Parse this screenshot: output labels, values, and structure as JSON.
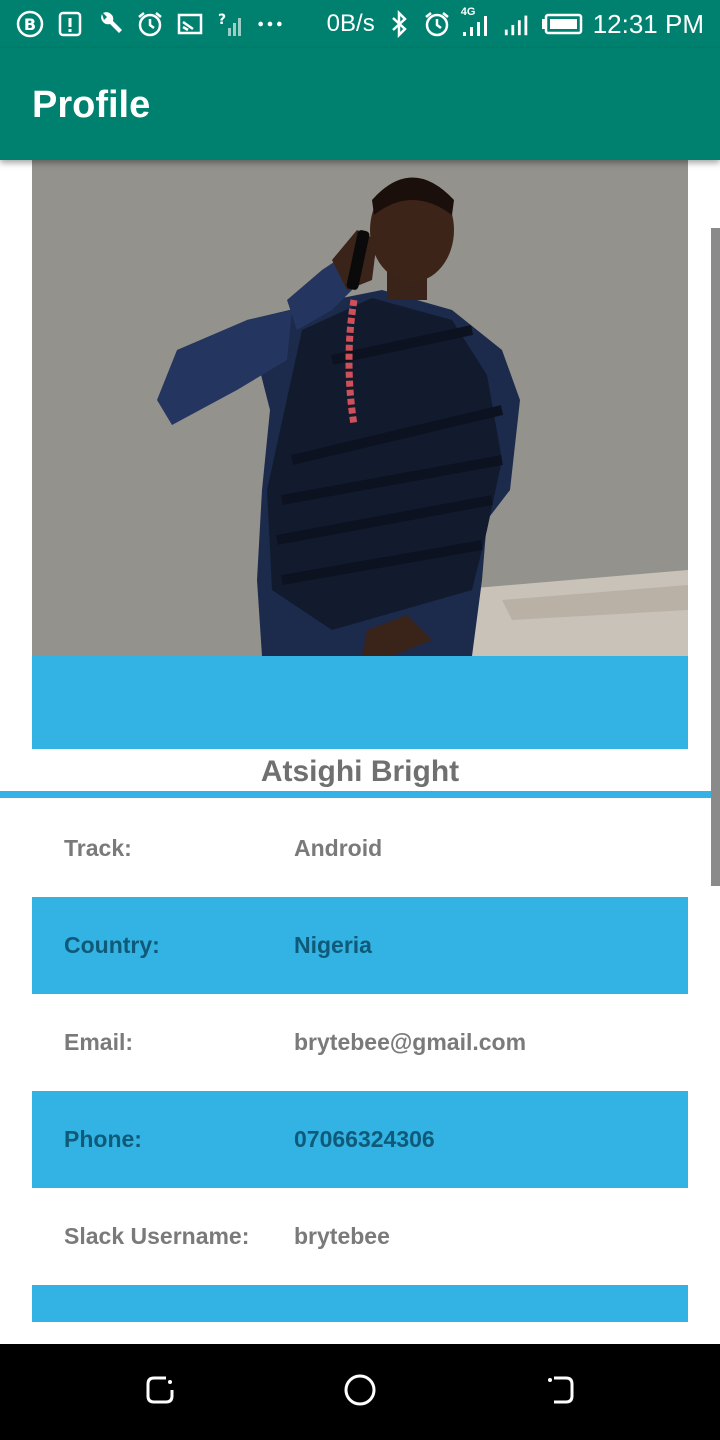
{
  "status_bar": {
    "network_speed": "0B/s",
    "network_type": "4G",
    "time": "12:31 PM",
    "icons_left": [
      "b-badge-icon",
      "alert-icon",
      "wrench-icon",
      "alarm-icon",
      "cast-icon",
      "signal-unknown-icon",
      "more-dots-icon"
    ],
    "icons_right": [
      "bluetooth-icon",
      "alarm-icon",
      "signal-4g-icon",
      "signal-icon",
      "battery-icon"
    ]
  },
  "app_bar": {
    "title": "Profile"
  },
  "profile": {
    "name": "Atsighi Bright",
    "photo_icon": "profile-photo"
  },
  "details": [
    {
      "label": "Track:",
      "value": "Android"
    },
    {
      "label": "Country:",
      "value": "Nigeria"
    },
    {
      "label": "Email:",
      "value": "brytebee@gmail.com"
    },
    {
      "label": "Phone:",
      "value": "07066324306"
    },
    {
      "label": "Slack Username:",
      "value": "brytebee"
    }
  ],
  "nav_bar": {
    "buttons": [
      "recents-icon",
      "home-icon",
      "back-icon"
    ]
  },
  "colors": {
    "primary": "#00816f",
    "accent": "#33b3e3",
    "label_text": "#7a7a7a",
    "alt_text": "#0f5a78"
  }
}
